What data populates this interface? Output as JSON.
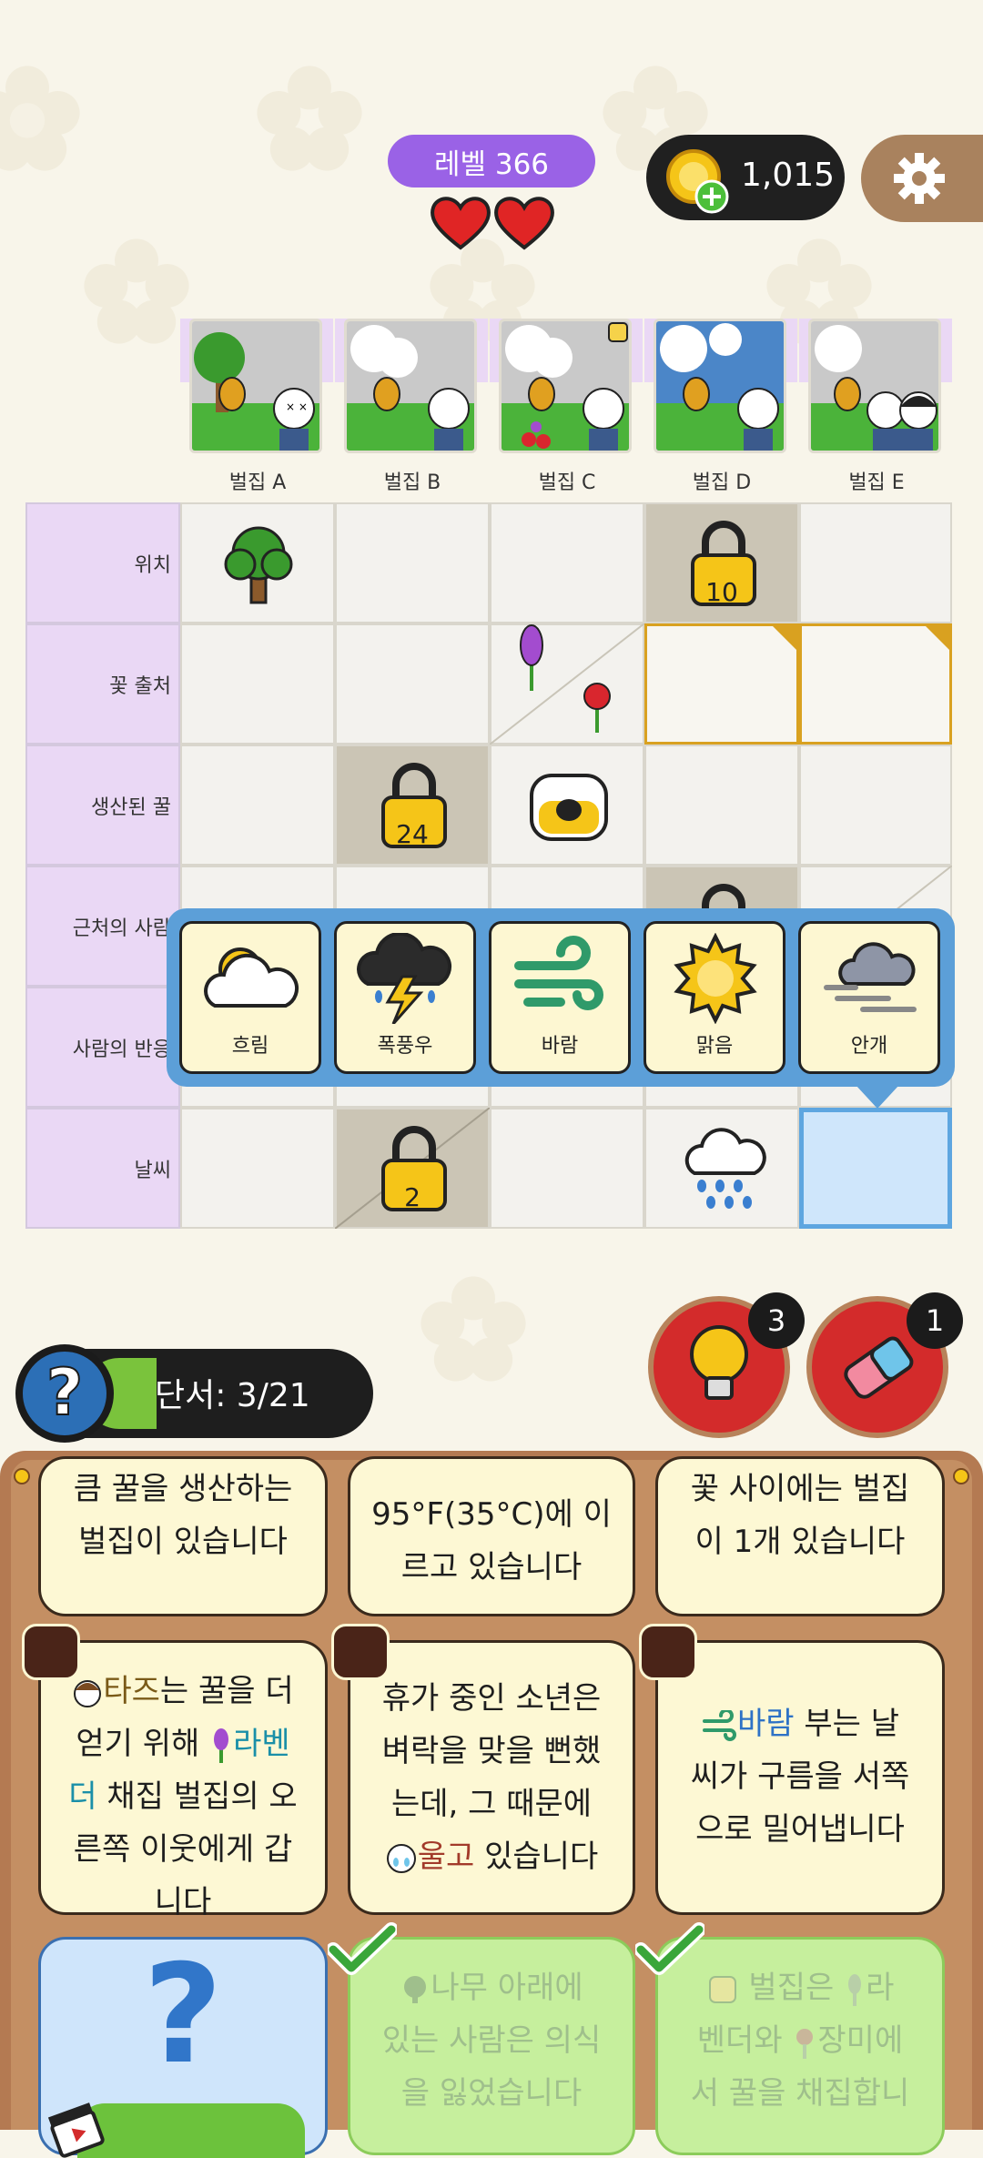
{
  "header": {
    "level_label": "레벨 366",
    "lives": 2,
    "coins": "1,015"
  },
  "columns": [
    {
      "label": "벌집 A"
    },
    {
      "label": "벌집 B"
    },
    {
      "label": "벌집 C"
    },
    {
      "label": "벌집 D"
    },
    {
      "label": "벌집 E"
    }
  ],
  "rows": [
    {
      "label": "위치"
    },
    {
      "label": "꽃 출처"
    },
    {
      "label": "생산된 꿀"
    },
    {
      "label": "근처의 사람"
    },
    {
      "label": "사람의 반응"
    },
    {
      "label": "날씨"
    }
  ],
  "locks": {
    "r1_d": "10",
    "r3_b": "24",
    "r6_b": "2"
  },
  "weather_options": [
    {
      "label": "흐림",
      "icon": "partly-cloudy-icon"
    },
    {
      "label": "폭풍우",
      "icon": "storm-icon"
    },
    {
      "label": "바람",
      "icon": "wind-icon"
    },
    {
      "label": "맑음",
      "icon": "sun-icon"
    },
    {
      "label": "안개",
      "icon": "fog-icon"
    }
  ],
  "clues": {
    "progress_label": "단서: 3/21",
    "hints_count": "3",
    "erasers_count": "1",
    "cards": {
      "c1": [
        "큼 꿀을 생산하는",
        "벌집이 있습니다"
      ],
      "c2": [
        "95°F(35°C)에 이",
        "르고 있습니다"
      ],
      "c3": [
        "꽃 사이에는 벌집",
        "이 1개 있습니다"
      ],
      "c4_a": "타즈",
      "c4_b": "는 꿀을 더",
      "c4_c": "얻기 위해",
      "c4_d": "라벤",
      "c4_e": "더",
      "c4_f": " 채집 벌집의 오",
      "c4_g": "른쪽 이웃에게 갑",
      "c4_h": "니다",
      "c5_l1": "휴가 중인 소년은",
      "c5_l2": "벼락을 맞을 뻔했",
      "c5_l3": "는데, 그 때문에",
      "c5_a": "울고",
      "c5_b": " 있습니다",
      "c6_a": "바람",
      "c6_b": " 부는 날",
      "c6_l2": "씨가 구름을 서쪽",
      "c6_l3": "으로 밀어냅니다",
      "c8_a": "나무",
      "c8_b": " 아래에",
      "c8_l2": "있는 사람은 의식",
      "c8_l3": "을 잃었습니다",
      "c9_a": " 벌집은 ",
      "c9_b": "라",
      "c9_c": "벤더",
      "c9_d": "와 ",
      "c9_e": "장미",
      "c9_f": "에",
      "c9_l3": "서 꿀을 채집합니",
      "c7_mark": "?"
    }
  },
  "colors": {
    "level_pill": "#9a62e6",
    "grid_header": "#ead8f5",
    "selected_cell": "#cfe6fb",
    "popup": "#5c9fd8",
    "wood": "#b47a52"
  }
}
